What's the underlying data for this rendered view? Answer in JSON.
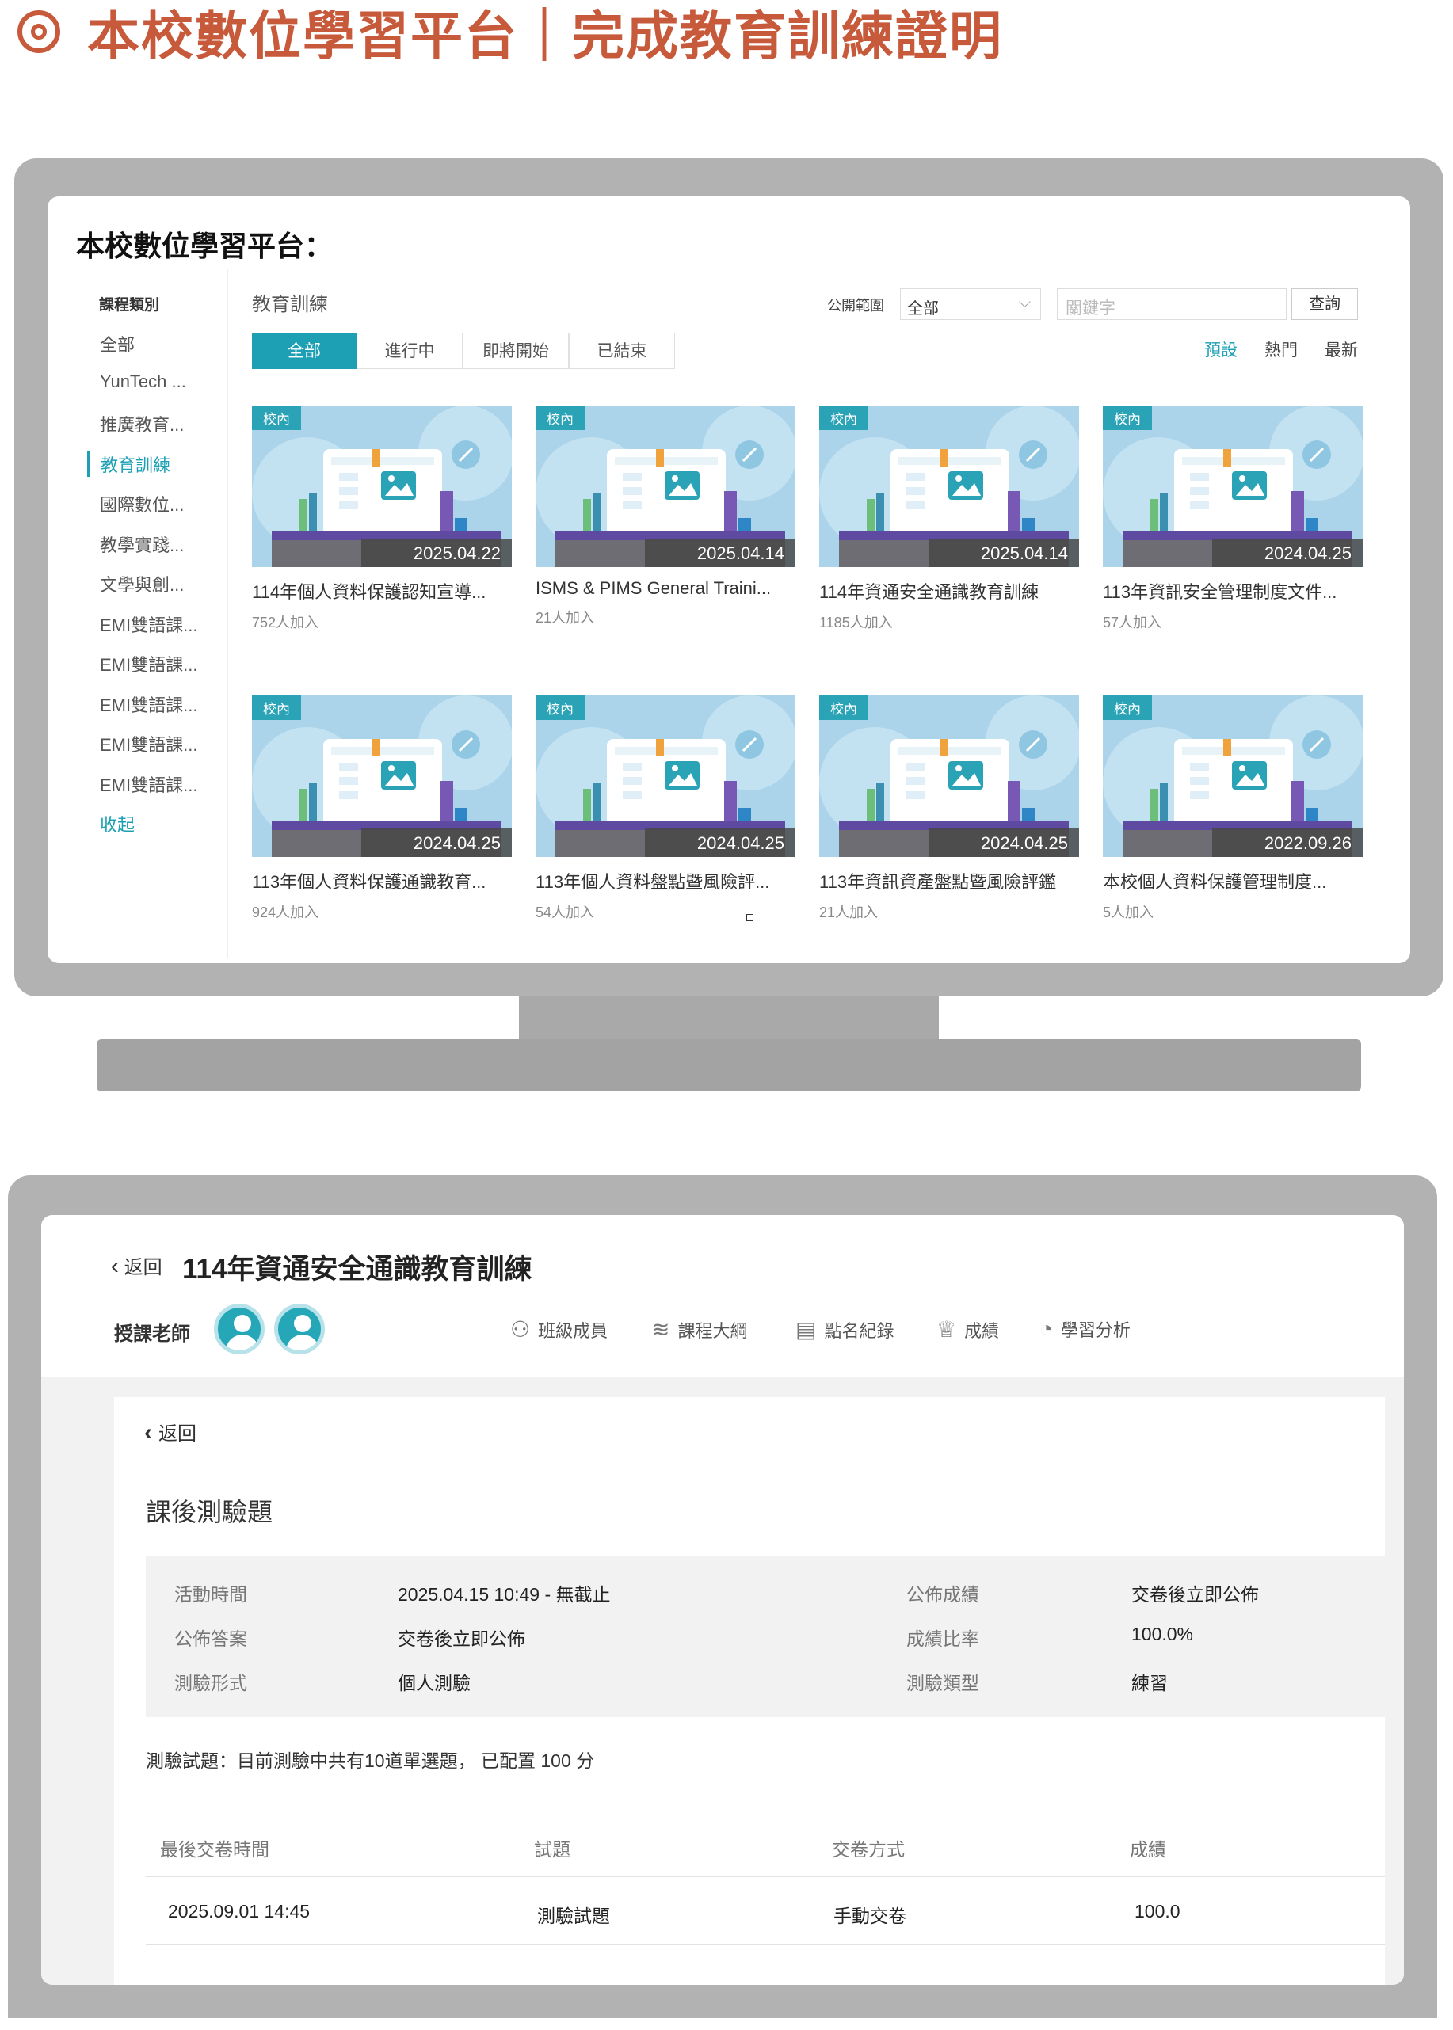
{
  "heading": "本校數位學習平台｜完成教育訓練證明",
  "screen1": {
    "title": "本校數位學習平台：",
    "sidebar": {
      "heading": "課程類別",
      "items": [
        "全部",
        "YunTech ...",
        "推廣教育...",
        "教育訓練",
        "國際數位...",
        "教學實踐...",
        "文學與創...",
        "EMI雙語課...",
        "EMI雙語課...",
        "EMI雙語課...",
        "EMI雙語課...",
        "EMI雙語課..."
      ],
      "active_index": 3,
      "collapse": "收起"
    },
    "breadcrumb": "教育訓練",
    "filters": [
      "全部",
      "進行中",
      "即將開始",
      "已結束"
    ],
    "scope_label": "公開範圍",
    "scope_value": "全部",
    "keyword_placeholder": "關鍵字",
    "search_button": "查詢",
    "sort": [
      "預設",
      "熱門",
      "最新"
    ],
    "courses": [
      {
        "tag": "校內",
        "date": "2025.04.22",
        "title": "114年個人資料保護認知宣導...",
        "joined": "752人加入"
      },
      {
        "tag": "校內",
        "date": "2025.04.14",
        "title": "ISMS & PIMS General Traini...",
        "joined": "21人加入"
      },
      {
        "tag": "校內",
        "date": "2025.04.14",
        "title": "114年資通安全通識教育訓練",
        "joined": "1185人加入"
      },
      {
        "tag": "校內",
        "date": "2024.04.25",
        "title": "113年資訊安全管理制度文件...",
        "joined": "57人加入"
      },
      {
        "tag": "校內",
        "date": "2024.04.25",
        "title": "113年個人資料保護通識教育...",
        "joined": "924人加入"
      },
      {
        "tag": "校內",
        "date": "2024.04.25",
        "title": "113年個人資料盤點暨風險評...",
        "joined": "54人加入"
      },
      {
        "tag": "校內",
        "date": "2024.04.25",
        "title": "113年資訊資產盤點暨風險評鑑",
        "joined": "21人加入"
      },
      {
        "tag": "校內",
        "date": "2022.09.26",
        "title": "本校個人資料保護管理制度...",
        "joined": "5人加入"
      }
    ]
  },
  "screen2": {
    "back_label": "返回",
    "course_title": "114年資通安全通識教育訓練",
    "teacher_label": "授課老師",
    "tabs": [
      "班級成員",
      "課程大綱",
      "點名紀錄",
      "成績",
      "學習分析"
    ],
    "panel_back": "返回",
    "quiz_title": "課後測驗題",
    "info": {
      "activity_time_label": "活動時間",
      "activity_time": "2025.04.15 10:49 - 無截止",
      "publish_score_label": "公佈成績",
      "publish_score": "交卷後立即公佈",
      "publish_answer_label": "公佈答案",
      "publish_answer": "交卷後立即公佈",
      "score_ratio_label": "成績比率",
      "score_ratio": "100.0%",
      "quiz_form_label": "測驗形式",
      "quiz_form": "個人測驗",
      "quiz_type_label": "測驗類型",
      "quiz_type": "練習"
    },
    "quiz_desc": "測驗試題：目前測驗中共有10道單選題， 已配置 100 分",
    "table": {
      "headers": [
        "最後交卷時間",
        "試題",
        "交卷方式",
        "成績"
      ],
      "rows": [
        [
          "2025.09.01 14:45",
          "測驗試題",
          "手動交卷",
          "100.0"
        ]
      ]
    }
  },
  "colors": {
    "accent": "#1ea0b4",
    "heading": "#c85a3c",
    "monitor": "#b2b2b2"
  }
}
